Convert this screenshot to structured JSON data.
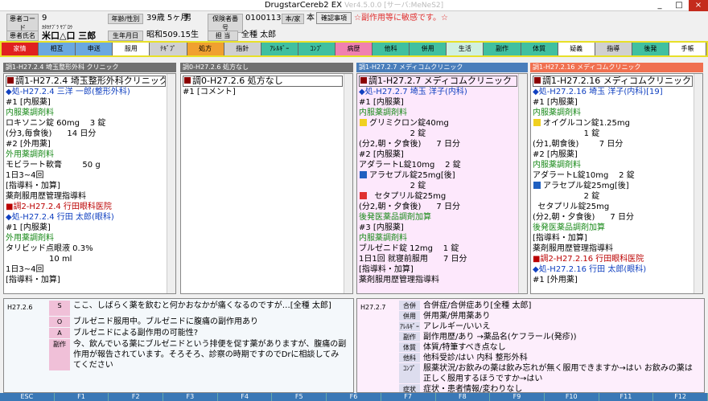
{
  "window": {
    "title": "DrugstarCereb2 EX",
    "version": "Ver4.5.0.0 [サーバ:MeNeS2]",
    "buttons": [
      "_",
      "□",
      "×"
    ]
  },
  "header": {
    "patient_code_label": "患者コード",
    "patient_code": "9",
    "age_sex_label": "年齢/性別",
    "age": "39歳 5ヶ月",
    "sex": "男",
    "insurer_label": "保険者番号",
    "insurer": "01001131",
    "self_family_label": "本/家",
    "self_family": "本",
    "confirm_label": "確認事項",
    "confirm_note": "☆副作用等に敏感です。☆",
    "name_label": "患者氏名",
    "name_kana": "ｶﾀｶﾅﾌﾞﾗ ｻﾌﾞﾛｳ",
    "name": "米口△口 三郎",
    "birth_label": "生年月日",
    "birth": "昭和509.15生",
    "staff_label": "担 当",
    "staff": "全種 太郎"
  },
  "tabs": [
    {
      "label": "家情",
      "color": "#e02020"
    },
    {
      "label": "相互",
      "color": "#6aa8e0"
    },
    {
      "label": "申送",
      "color": "#6aa8e0"
    },
    {
      "label": "服用",
      "color": "#ffffff"
    },
    {
      "label": "ﾃｷﾞﾌﾟ",
      "color": "#d0d0d0"
    },
    {
      "label": "処方",
      "color": "#f0a030"
    },
    {
      "label": "指針",
      "color": "#d0d0d0"
    },
    {
      "label": "ｱﾚﾙｷﾞｰ",
      "color": "#40c0a0"
    },
    {
      "label": "ｺﾝﾌﾟ",
      "color": "#40c0a0"
    },
    {
      "label": "病歴",
      "color": "#f080b0"
    },
    {
      "label": "他科",
      "color": "#40c0a0"
    },
    {
      "label": "併用",
      "color": "#40c0a0"
    },
    {
      "label": "生活",
      "color": "#d0f0e0"
    },
    {
      "label": "副作",
      "color": "#40c0a0"
    },
    {
      "label": "体質",
      "color": "#40c0a0"
    },
    {
      "label": "疑義",
      "color": "#ffffff"
    },
    {
      "label": "指導",
      "color": "#d0d0d0"
    },
    {
      "label": "後発",
      "color": "#40c0a0"
    },
    {
      "label": "手帳",
      "color": "#ffffff"
    }
  ],
  "panes": [
    {
      "head": "調1-H27.2.4 埼玉整形外科 クリニック",
      "head_color": "#707070",
      "bg": "#ffffff",
      "lines": [
        {
          "t": "h",
          "s": "調1-H27.2.4 埼玉整形外科クリニック"
        },
        {
          "t": "rx",
          "s": "◆処-H27.2.4 三洋 一郎(整形外科)"
        },
        {
          "t": "n",
          "s": "#1 [内服薬]"
        },
        {
          "t": "sec",
          "s": "内服薬調剤料"
        },
        {
          "t": "n",
          "s": "ロキソニン錠 60mg    3 錠"
        },
        {
          "t": "n",
          "s": "(分3,毎食後)      14 日分"
        },
        {
          "t": "n",
          "s": "#2 [外用薬]"
        },
        {
          "t": "sec",
          "s": "外用薬調剤料"
        },
        {
          "t": "n",
          "s": "モビラート軟膏        50 g"
        },
        {
          "t": "n",
          "s": "1日3~4回"
        },
        {
          "t": "n",
          "s": "[指導料・加算]"
        },
        {
          "t": "n",
          "s": "薬剤服用歴管理指導料"
        },
        {
          "t": "ttl2",
          "s": "■調2-H27.2.4 行田眼科医院"
        },
        {
          "t": "rx",
          "s": "◆処-H27.2.4 行田 太郎(眼科)"
        },
        {
          "t": "n",
          "s": "#1 [内服薬]"
        },
        {
          "t": "sec",
          "s": "外用薬調剤料"
        },
        {
          "t": "n",
          "s": "タリビッド点眼液 0.3%"
        },
        {
          "t": "n",
          "s": "                 10 ml"
        },
        {
          "t": "n",
          "s": "1日3~4回"
        },
        {
          "t": "n",
          "s": "[指導料・加算]"
        }
      ]
    },
    {
      "head": "調0-H27.2.6 処方なし",
      "head_color": "#707070",
      "bg": "#ffffff",
      "lines": [
        {
          "t": "h",
          "s": "調0-H27.2.6 処方なし"
        },
        {
          "t": "n",
          "s": "#1 [コメント]"
        }
      ]
    },
    {
      "head": "調1-H27.2.7 メディコムクリニック",
      "head_color": "#4a7ebb",
      "bg": "#fde8fc",
      "lines": [
        {
          "t": "h",
          "s": "調1-H27.2.7 メディコムクリニック"
        },
        {
          "t": "rx",
          "s": "◆処-H27.2.7 埼玉 洋子(内科)"
        },
        {
          "t": "n",
          "s": "#1 [内服薬]"
        },
        {
          "t": "sec",
          "s": "内服薬調剤料"
        },
        {
          "t": "n",
          "i": "y",
          "s": "グリミクロン錠40mg"
        },
        {
          "t": "n",
          "s": "                    2 錠"
        },
        {
          "t": "n",
          "s": "(分2,朝・夕食後)      7 日分"
        },
        {
          "t": "n",
          "s": "#2 [内服薬]"
        },
        {
          "t": "n",
          "s": "アダラートL錠10mg    2 錠"
        },
        {
          "t": "n",
          "i": "b",
          "s": "アラセプル錠25mg[後]"
        },
        {
          "t": "n",
          "s": "                    2 錠"
        },
        {
          "t": "n",
          "i": "r",
          "s": "  セタプリル錠25mg"
        },
        {
          "t": "n",
          "s": "(分2,朝・夕食後)      7 日分"
        },
        {
          "t": "sec",
          "s": "後発医薬品調剤加算"
        },
        {
          "t": "n",
          "s": "#3 [内服薬]"
        },
        {
          "t": "sec",
          "s": "内服薬調剤料"
        },
        {
          "t": "n",
          "s": "ブルゼニド錠 12mg    1 錠"
        },
        {
          "t": "n",
          "s": "1日1回 就寝前服用      7 日分"
        },
        {
          "t": "n",
          "s": "[指導料・加算]"
        },
        {
          "t": "n",
          "s": "薬剤服用歴管理指導料"
        }
      ]
    },
    {
      "head": "調1-H27.2.16 メディコムクリニック",
      "head_color": "#f07050",
      "bg": "#ffffff",
      "lines": [
        {
          "t": "h",
          "s": "調1-H27.2.16 メディコムクリニック"
        },
        {
          "t": "rx",
          "s": "◆処-H27.2.16 埼玉 洋子(内科)[19]"
        },
        {
          "t": "n",
          "s": "#1 [内服薬]"
        },
        {
          "t": "sec",
          "s": "内服薬調剤料"
        },
        {
          "t": "n",
          "i": "y",
          "s": "オイグルコン錠1.25mg"
        },
        {
          "t": "n",
          "s": "                    1 錠"
        },
        {
          "t": "n",
          "s": "(分1,朝食後)        7 日分"
        },
        {
          "t": "n",
          "s": "#2 [内服薬]"
        },
        {
          "t": "sec",
          "s": "内服薬調剤料"
        },
        {
          "t": "n",
          "s": "アダラートL錠10mg    2 錠"
        },
        {
          "t": "n",
          "i": "b",
          "s": "アラセプル錠25mg[後]"
        },
        {
          "t": "n",
          "s": "                    2 錠"
        },
        {
          "t": "n",
          "s": "  セタプリル錠25mg"
        },
        {
          "t": "n",
          "s": "(分2,朝・夕食後)      7 日分"
        },
        {
          "t": "sec",
          "s": "後発医薬品調剤加算"
        },
        {
          "t": "n",
          "s": "[指導料・加算]"
        },
        {
          "t": "n",
          "s": "薬剤服用歴管理指導料"
        },
        {
          "t": "ttl2",
          "s": "■調2-H27.2.16 行田眼科医院"
        },
        {
          "t": "rx",
          "s": "◆処-H27.2.16 行田 太郎(眼科)"
        },
        {
          "t": "n",
          "s": "#1 [外用薬]"
        }
      ]
    }
  ],
  "soap_left": {
    "date": "H27.2.6",
    "rows": [
      {
        "key": "S",
        "color": "#f0c0d8",
        "text": "ここ、しばらく薬を飲むと何かおなかが痛くなるのですが…[全種 太郎]"
      },
      {
        "key": "O",
        "color": "#f0c0d8",
        "text": "ブルゼニド服用中。ブルゼニドに腹痛の副作用あり"
      },
      {
        "key": "A",
        "color": "#f0c0d8",
        "text": "ブルゼニドによる副作用の可能性?"
      },
      {
        "key": "副作",
        "color": "#f0c0d8",
        "text": "今、飲んでいる薬にブルゼニドという排便を促す薬がありますが、腹痛の副作用が報告されています。そろそろ、診察の時期ですのでDrに相談してみてください"
      }
    ]
  },
  "soap_right": {
    "date": "H27.2.7",
    "rows": [
      {
        "key": "合併",
        "text": "合併症/合併症あり[全種 太郎]"
      },
      {
        "key": "併用",
        "text": "併用薬/併用薬あり"
      },
      {
        "key": "ｱﾚﾙｷﾞｰ",
        "text": "アレルギー/いいえ"
      },
      {
        "key": "副作",
        "text": "副作用歴/あり →薬品名(ケフラール(発疹))"
      },
      {
        "key": "体質",
        "text": "体質/特筆すべき点なし"
      },
      {
        "key": "他科",
        "text": "他科受診/はい 内科 整形外科"
      },
      {
        "key": "ｺﾝﾌﾟ",
        "text": "服薬状況/お飲みの薬は飲み忘れが無く服用できますか→はい お飲みの薬は正しく服用するほうですか→はい"
      },
      {
        "key": "症状",
        "text": "症状・患者情報/変わりなし"
      }
    ]
  },
  "fkeys": [
    "ESC",
    "F1",
    "F2",
    "F3",
    "F4",
    "F5",
    "F6",
    "F7",
    "F8",
    "F9",
    "F10",
    "F11",
    "F12"
  ]
}
